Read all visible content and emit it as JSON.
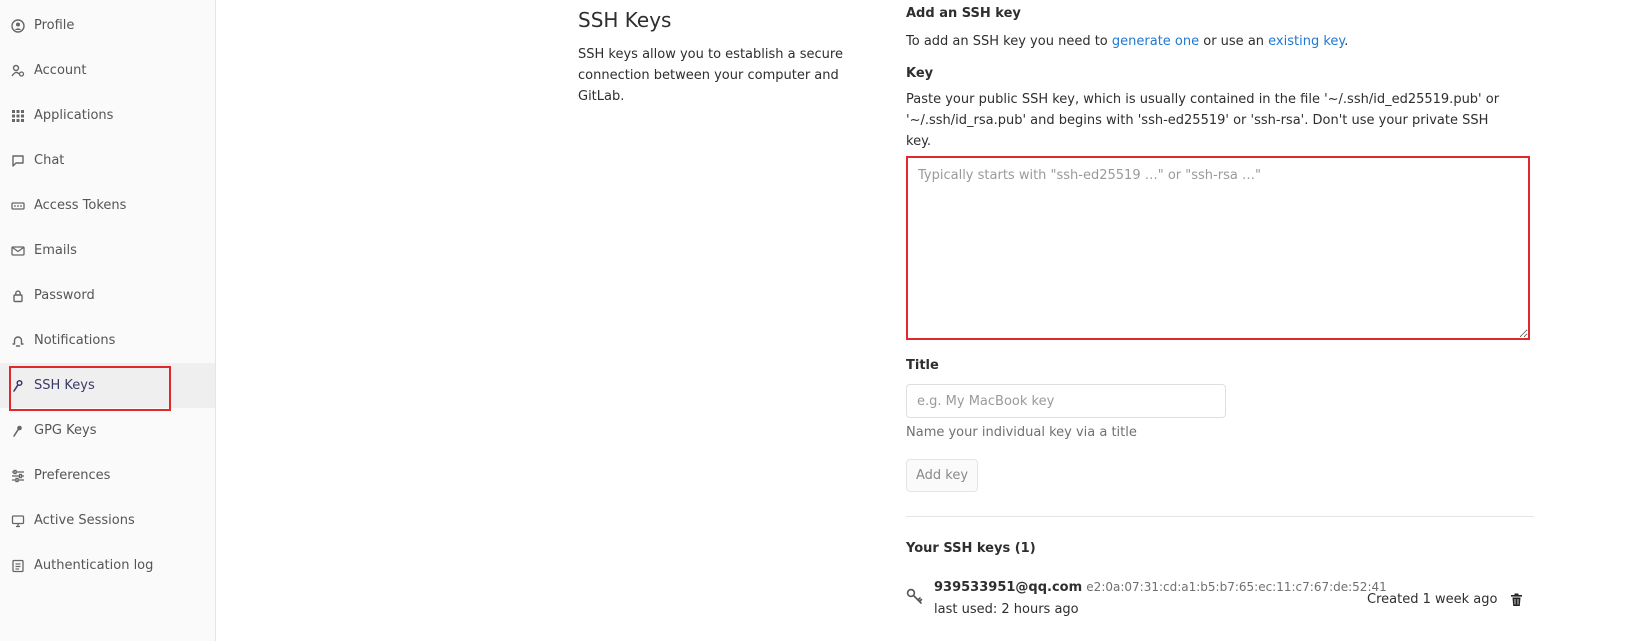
{
  "sidebar": {
    "items": [
      {
        "label": "Profile",
        "icon": "profile-icon"
      },
      {
        "label": "Account",
        "icon": "account-icon"
      },
      {
        "label": "Applications",
        "icon": "applications-icon"
      },
      {
        "label": "Chat",
        "icon": "chat-icon"
      },
      {
        "label": "Access Tokens",
        "icon": "access-tokens-icon"
      },
      {
        "label": "Emails",
        "icon": "email-icon"
      },
      {
        "label": "Password",
        "icon": "lock-icon"
      },
      {
        "label": "Notifications",
        "icon": "bell-icon"
      },
      {
        "label": "SSH Keys",
        "icon": "key-icon",
        "active": true
      },
      {
        "label": "GPG Keys",
        "icon": "key-icon"
      },
      {
        "label": "Preferences",
        "icon": "sliders-icon"
      },
      {
        "label": "Active Sessions",
        "icon": "monitor-icon"
      },
      {
        "label": "Authentication log",
        "icon": "log-icon"
      }
    ]
  },
  "section": {
    "title": "SSH Keys",
    "description": "SSH keys allow you to establish a secure connection between your computer and GitLab."
  },
  "form": {
    "heading": "Add an SSH key",
    "intro_prefix": "To add an SSH key you need to ",
    "intro_link1": "generate one",
    "intro_middle": " or use an ",
    "intro_link2": "existing key",
    "intro_suffix": ".",
    "key_label": "Key",
    "key_help": "Paste your public SSH key, which is usually contained in the file '~/.ssh/id_ed25519.pub' or '~/.ssh/id_rsa.pub' and begins with 'ssh-ed25519' or 'ssh-rsa'. Don't use your private SSH key.",
    "key_placeholder": "Typically starts with \"ssh-ed25519 …\" or \"ssh-rsa …\"",
    "title_label": "Title",
    "title_placeholder": "e.g. My MacBook key",
    "title_help": "Name your individual key via a title",
    "add_button": "Add key"
  },
  "keys_list": {
    "heading": "Your SSH keys (1)",
    "items": [
      {
        "name": "939533951@qq.com",
        "fingerprint": "e2:0a:07:31:cd:a1:b5:b7:65:ec:11:c7:67:de:52:41",
        "last_used": "last used: 2 hours ago",
        "created": "Created 1 week ago"
      }
    ]
  },
  "colors": {
    "link": "#1f78d1",
    "highlight": "#dd2b2b",
    "active_nav_text": "#3a3a67"
  }
}
